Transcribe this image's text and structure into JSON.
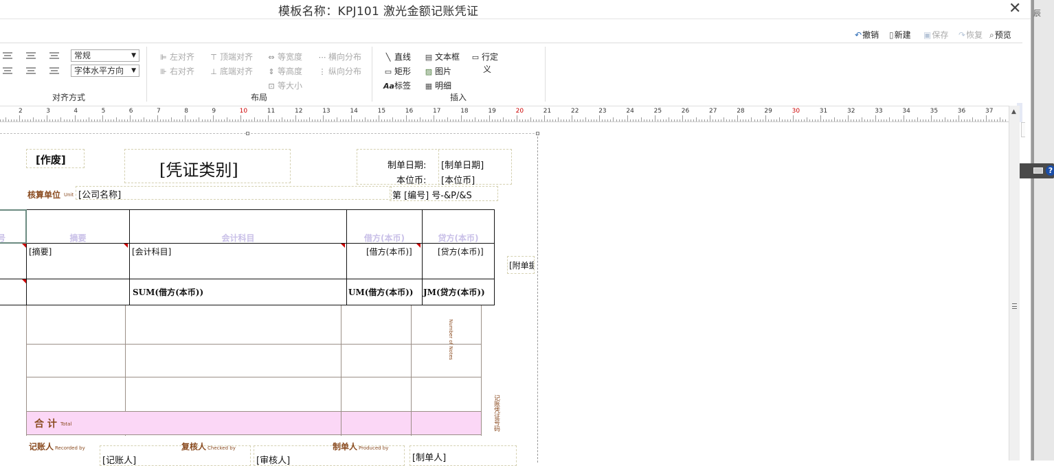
{
  "window": {
    "title": "模板名称：KPJ101 激光金额记账凭证",
    "close_glyph": "✕",
    "strip_char": "辰"
  },
  "quick_toolbar": {
    "undo": "撤销",
    "new": "新建",
    "save": "保存",
    "restore": "恢复",
    "preview": "预览"
  },
  "ribbon": {
    "align_group": {
      "label": "对齐方式",
      "font_style": "常规",
      "h_align": "字体水平方向"
    },
    "layout_group": {
      "label": "布局",
      "left_align": "左对齐",
      "right_align": "右对齐",
      "top_align": "顶端对齐",
      "bottom_align": "底端对齐",
      "same_width": "等宽度",
      "same_height": "等高度",
      "same_size": "等大小",
      "h_distribute": "横向分布",
      "v_distribute": "纵向分布"
    },
    "insert_group": {
      "label": "插入",
      "line": "直线",
      "rect": "矩形",
      "label_item": "标签",
      "textbox": "文本框",
      "image": "图片",
      "detail": "明细",
      "custom_line_1": "行定",
      "custom_line_2": "义"
    }
  },
  "ruler": {
    "numbers": [
      "2",
      "3",
      "4",
      "5",
      "6",
      "7",
      "8",
      "9",
      "10",
      "11",
      "12",
      "13",
      "14",
      "15",
      "16",
      "17",
      "18",
      "19",
      "20",
      "21",
      "22",
      "23",
      "24",
      "25",
      "26",
      "27",
      "28",
      "29",
      "30",
      "31",
      "32",
      "33",
      "34",
      "35",
      "36",
      "37"
    ],
    "red_numbers": [
      "10",
      "20",
      "30"
    ]
  },
  "voucher": {
    "void_label": "[作废]",
    "voucher_type": "[凭证类别]",
    "make_date_label": "制单日期:",
    "make_date_value": "[制单日期]",
    "currency_label": "本位币:",
    "currency_value": "[本位币]",
    "number_label": "第",
    "number_value": "[编号] 号-&P/&S",
    "unit_label": "核算单位",
    "unit_label_en": "Unit",
    "company_value": "[公司名称]",
    "header_no": "号",
    "header_summary": "摘要",
    "header_account": "会计科目",
    "header_debit": "借方(本币)",
    "header_credit": "贷方(本币)",
    "row_summary": "[摘要]",
    "row_account": "[会计科目]",
    "row_debit": "[借方(本币)]",
    "row_credit": "[贷方(本币)]",
    "sum_account": "SUM(借方(本币))",
    "sum_debit": "UM(借方(本币))",
    "sum_credit": "JM(贷方(本币))",
    "attachment": "[附单据",
    "side_notes": "Number of Notes",
    "side_label": "记账凭证号码",
    "total_label": "合 计",
    "total_label_en": "Total",
    "recorder_label": "记账人",
    "recorder_en": "Recorded by",
    "recorder_value": "[记账人]",
    "checker_label": "复核人",
    "checker_en": "Checked by",
    "checker_value": "[审核人]",
    "maker_label": "制单人",
    "maker_en": "Produced by",
    "maker_value": "[制单人]"
  }
}
